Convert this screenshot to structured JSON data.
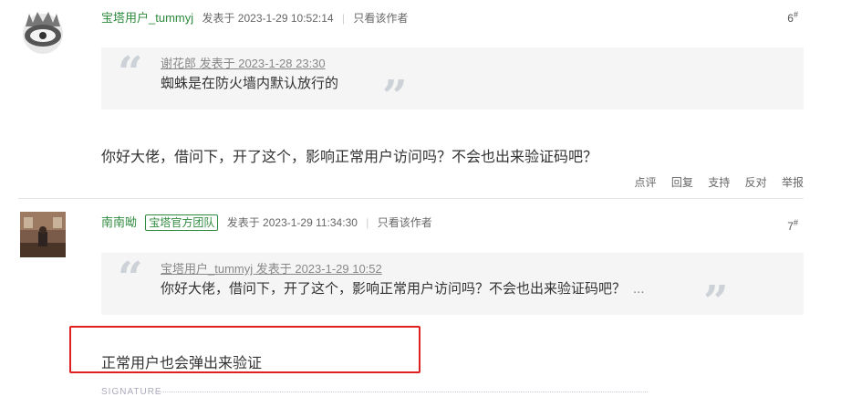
{
  "posts": [
    {
      "username": "宝塔用户_tummyj",
      "posted_label": "发表于 2023-1-29 10:52:14",
      "author_only": "只看该作者",
      "floor": "6",
      "floor_sup": "#",
      "quote": {
        "header": "谢花郎 发表于 2023-1-28 23:30",
        "body": "蜘蛛是在防火墙内默认放行的"
      },
      "content": "你好大佬，借问下，开了这个，影响正常用户访问吗？不会也出来验证码吧？",
      "actions": [
        "点评",
        "回复",
        "支持",
        "反对",
        "举报"
      ]
    },
    {
      "username": "南南呦",
      "badge": "宝塔官方团队",
      "posted_label": "发表于 2023-1-29 11:34:30",
      "author_only": "只看该作者",
      "floor": "7",
      "floor_sup": "#",
      "quote": {
        "header": "宝塔用户_tummyj 发表于 2023-1-29 10:52",
        "body": "你好大佬，借问下，开了这个，影响正常用户访问吗？不会也出来验证码吧？",
        "ellipsis": "..."
      },
      "content": "正常用户也会弹出来验证"
    }
  ],
  "signature_label": "SIGNATURE",
  "colors": {
    "username": "#2e8b3e",
    "highlight": "#e02020",
    "quote_bg": "#f5f5f5"
  }
}
